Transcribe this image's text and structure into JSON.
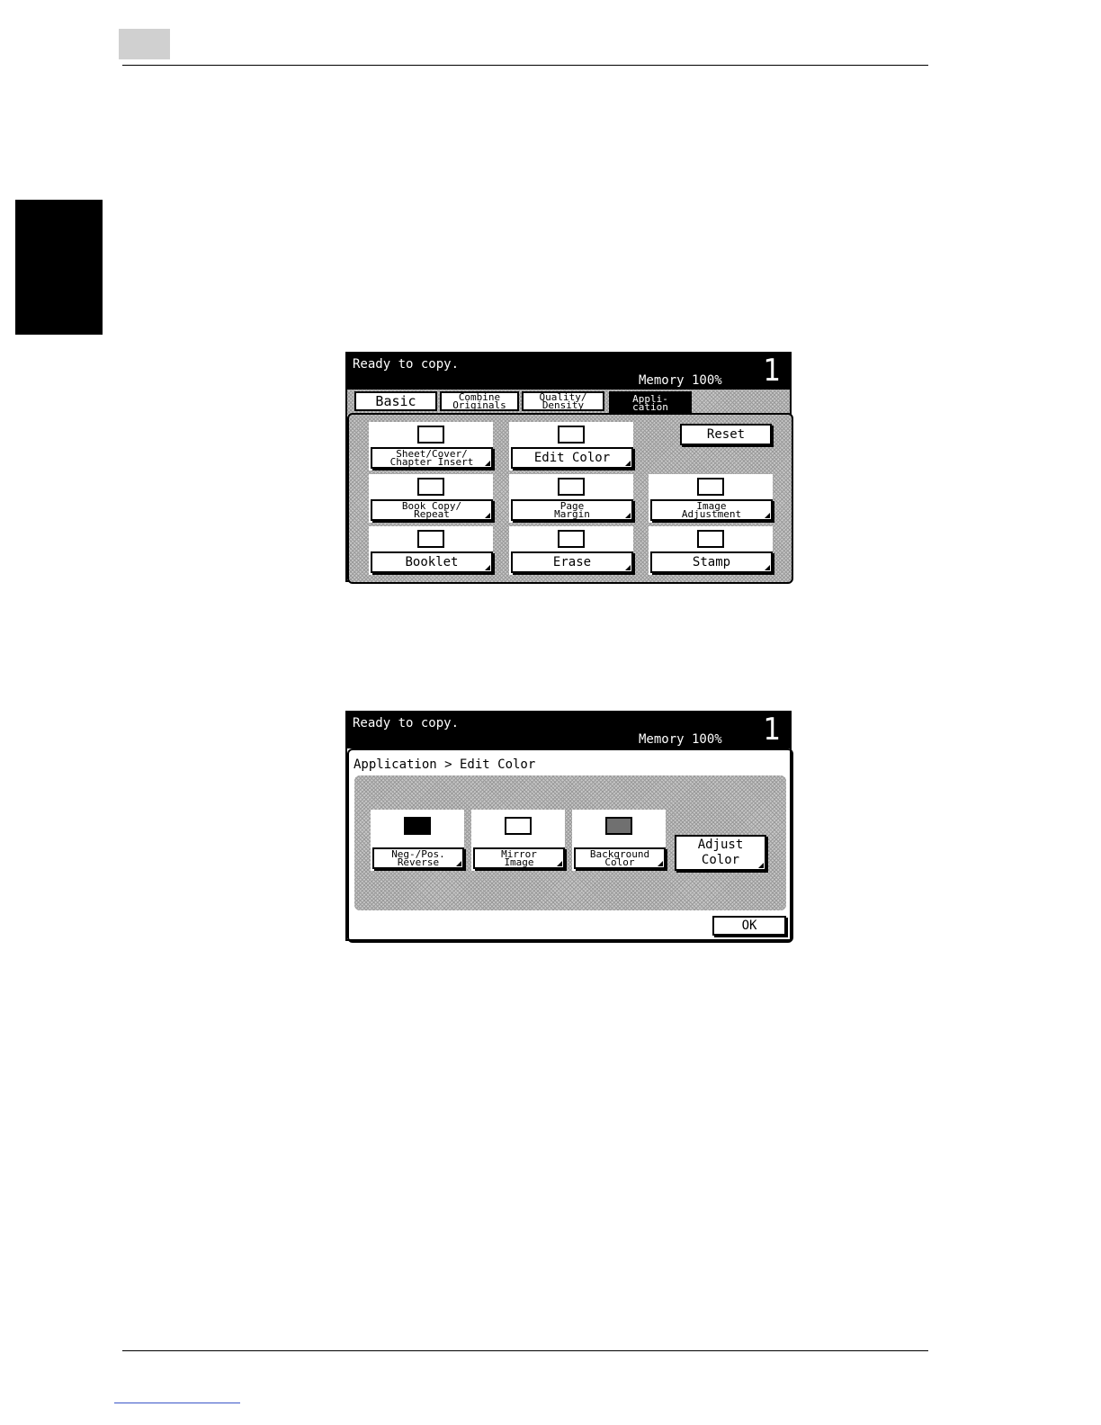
{
  "panel1": {
    "status": "Ready to copy.",
    "memory": "Memory  100%",
    "count": "1",
    "tabs": [
      {
        "label": "Basic"
      },
      {
        "label": "Combine\nOriginals"
      },
      {
        "label": "Quality/\nDensity"
      },
      {
        "label": "Appli-\ncation"
      }
    ],
    "buttons": [
      {
        "label": "Sheet/Cover/\nChapter Insert",
        "icon": "insert-sheet-icon"
      },
      {
        "label": "Edit Color",
        "icon": "banana-icon"
      },
      {
        "label": "Reset"
      },
      {
        "label": "Book Copy/\nRepeat",
        "icon": "book-copy-icon"
      },
      {
        "label": "Page\nMargin",
        "icon": "page-margin-icon"
      },
      {
        "label": "Image\nAdjustment",
        "icon": "image-adjust-icon"
      },
      {
        "label": "Booklet",
        "icon": "booklet-icon"
      },
      {
        "label": "Erase",
        "icon": "erase-icon"
      },
      {
        "label": "Stamp",
        "icon": "stamp-icon"
      }
    ]
  },
  "panel2": {
    "status": "Ready to copy.",
    "memory": "Memory  100%",
    "count": "1",
    "breadcrumb": "Application > Edit Color",
    "buttons": [
      {
        "label": "Neg-/Pos.\nReverse",
        "icon": "banana-negative-icon"
      },
      {
        "label": "Mirror\nImage",
        "icon": "banana-mirror-icon"
      },
      {
        "label": "Background\nColor",
        "icon": "banana-background-icon"
      },
      {
        "label": "Adjust\nColor"
      }
    ],
    "ok": "OK"
  }
}
